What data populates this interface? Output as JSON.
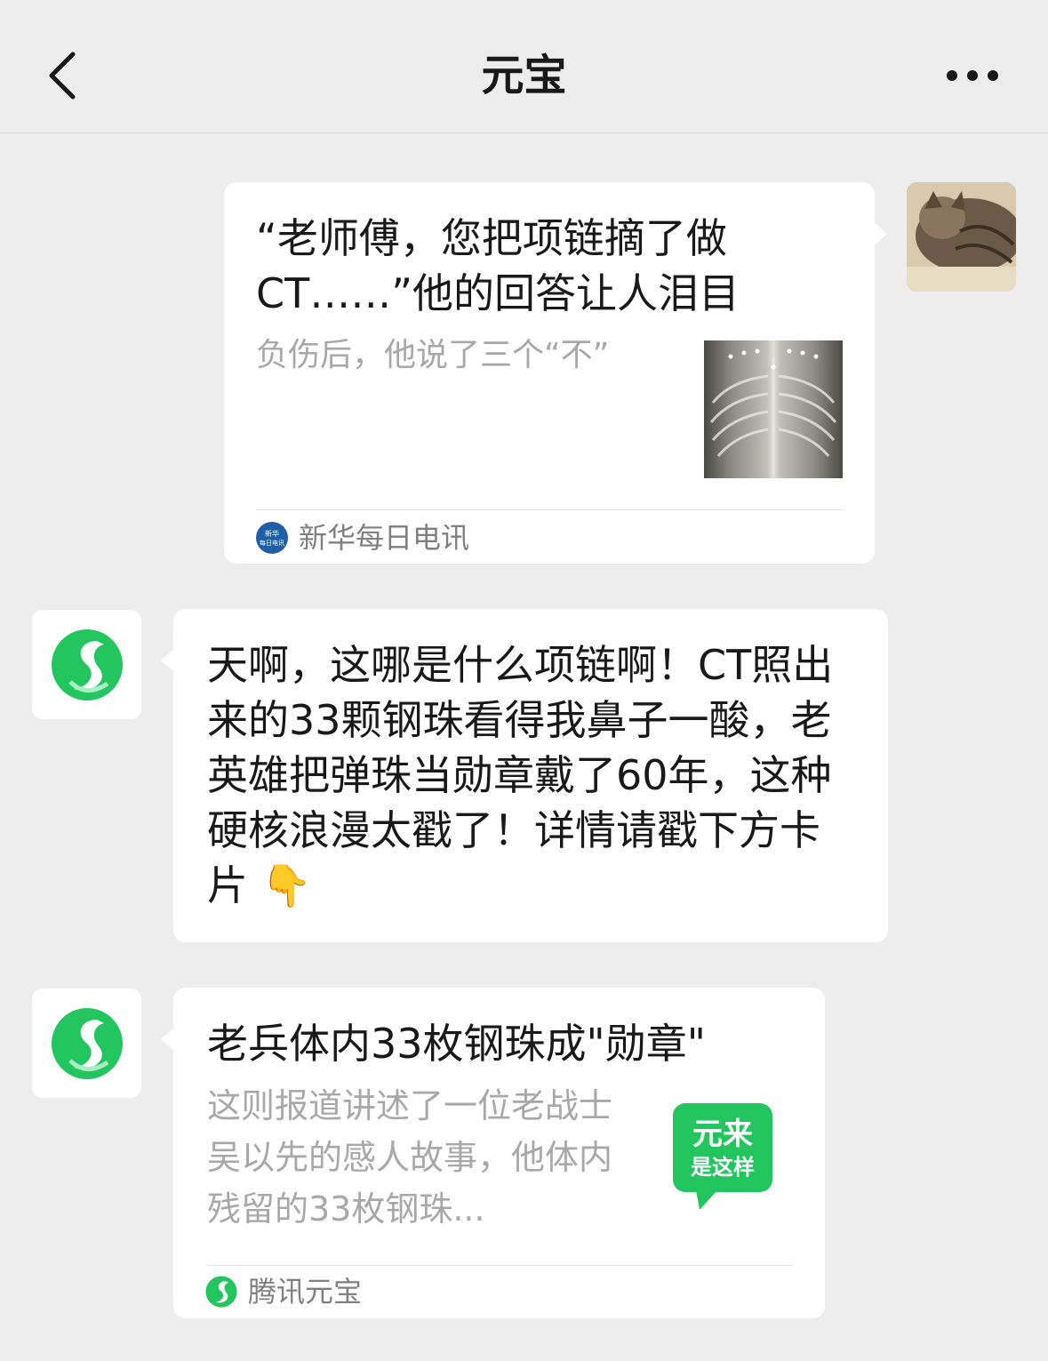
{
  "header": {
    "title": "元宝",
    "back_icon": "chevron-left-icon",
    "more_icon": "more-dots-icon"
  },
  "messages": {
    "user_article": {
      "headline": "“老师傅，您把项链摘了做CT……”他的回答让人泪目",
      "description": "负伤后，他说了三个“不”",
      "source": "新华每日电讯",
      "source_logo_text": "新华\n每日电讯"
    },
    "bot_reply": {
      "text": "天啊，这哪是什么项链啊！CT照出来的33颗钢珠看得我鼻子一酸，老英雄把弹珠当勋章戴了60年，这种硬核浪漫太戳了！详情请戳下方卡片",
      "emoji": "👇"
    },
    "bot_card": {
      "title": "老兵体内33枚钢珠成\"勋章\"",
      "description": "这则报道讲述了一位老战士吴以先的感人故事，他体内残留的33枚钢珠...",
      "tile_line1": "元来",
      "tile_line2": "是这样",
      "source": "腾讯元宝"
    }
  },
  "colors": {
    "background": "#ededed",
    "bubble": "#ffffff",
    "brand_green": "#22c55e",
    "secondary_text": "#a8a8a8"
  }
}
